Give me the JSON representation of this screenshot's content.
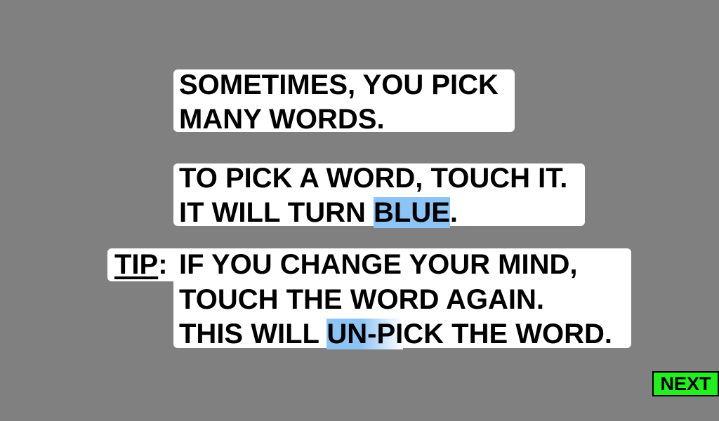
{
  "panel1": {
    "line1": "SOMETIMES, YOU PICK",
    "line2": "MANY WORDS."
  },
  "panel2": {
    "line1": "TO PICK A WORD, TOUCH IT.",
    "line2_prefix": "IT WILL TURN ",
    "line2_highlight": "BLUE",
    "line2_suffix": "."
  },
  "panel3": {
    "tip_label": "TIP",
    "tip_colon": ":",
    "line1": "IF YOU CHANGE YOUR MIND,",
    "line2": "TOUCH THE WORD AGAIN.",
    "line3_prefix": "THIS WILL ",
    "line3_highlight": "UN-PI",
    "line3_suffix": "CK THE WORD."
  },
  "next_button": {
    "label": "NEXT"
  },
  "colors": {
    "background": "#808080",
    "panel": "#ffffff",
    "highlight_blue": "#8ec3f5",
    "next_button": "#22ee22"
  }
}
